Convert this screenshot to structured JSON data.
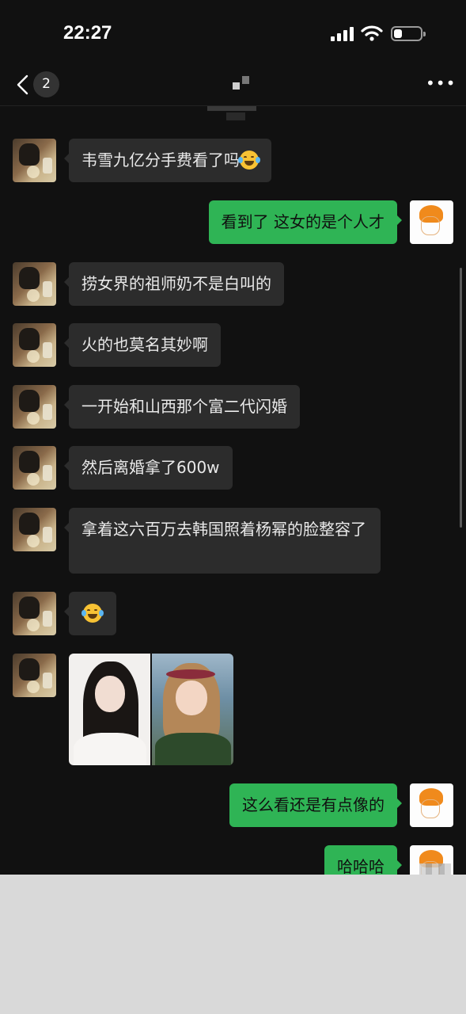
{
  "status_bar": {
    "time": "22:27",
    "battery_level": 0.3
  },
  "nav": {
    "unread_count": "2",
    "more_icon": "more-dots-icon",
    "back_icon": "chevron-left-icon"
  },
  "messages": [
    {
      "from": "them",
      "text": "韦雪九亿分手费看了吗",
      "emoji": "laughing-tears-emoji"
    },
    {
      "from": "me",
      "text": "看到了 这女的是个人才"
    },
    {
      "from": "them",
      "text": "捞女界的祖师奶不是白叫的"
    },
    {
      "from": "them",
      "text": "火的也莫名其妙啊"
    },
    {
      "from": "them",
      "text": "一开始和山西那个富二代闪婚"
    },
    {
      "from": "them",
      "text": "然后离婚拿了600w"
    },
    {
      "from": "them",
      "text": "拿着这六百万去韩国照着杨幂的脸整容了"
    },
    {
      "from": "them",
      "emoji": "laughing-tears-emoji"
    },
    {
      "from": "them",
      "image": "two-portrait-photos"
    },
    {
      "from": "me",
      "text": "这么看还是有点像的"
    },
    {
      "from": "me",
      "text": "哈哈哈"
    }
  ],
  "colors": {
    "background": "#111111",
    "bubble_them": "#2c2c2c",
    "bubble_me": "#2fb455",
    "text_them": "#e9e9e9",
    "text_me": "#101010"
  }
}
